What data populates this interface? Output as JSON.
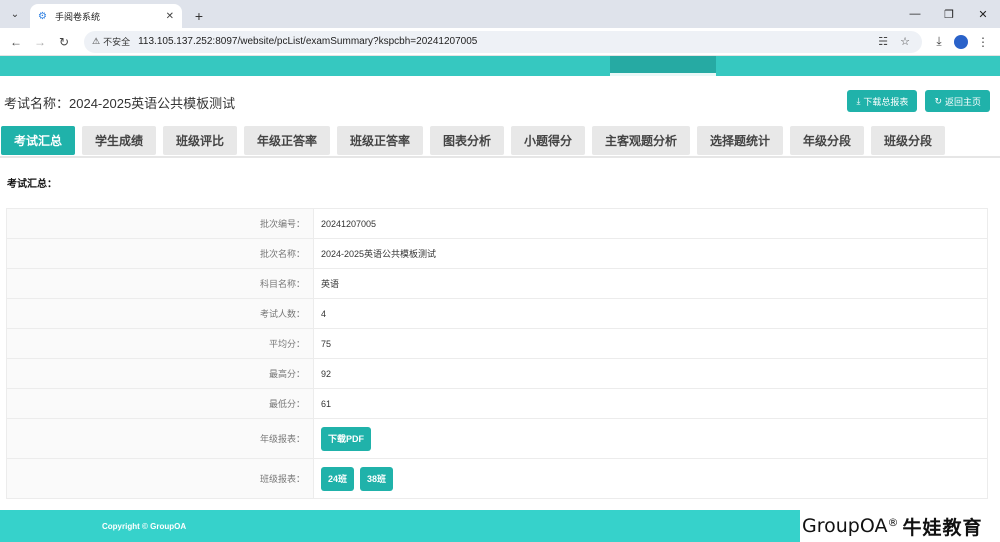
{
  "browser": {
    "tab_title": "手阅卷系统",
    "insecure_label": "不安全",
    "url": "113.105.137.252:8097/website/pcList/examSummary?kspcbh=20241207005"
  },
  "page": {
    "title_label": "考试名称：",
    "title_value": "2024-2025英语公共模板测试",
    "download_report": "下载总报表",
    "back_home": "返回主页"
  },
  "tabs": [
    {
      "label": "考试汇总",
      "active": true
    },
    {
      "label": "学生成绩"
    },
    {
      "label": "班级评比"
    },
    {
      "label": "年级正答率"
    },
    {
      "label": "班级正答率"
    },
    {
      "label": "图表分析"
    },
    {
      "label": "小题得分"
    },
    {
      "label": "主客观题分析"
    },
    {
      "label": "选择题统计"
    },
    {
      "label": "年级分段"
    },
    {
      "label": "班级分段"
    }
  ],
  "section_title": "考试汇总：",
  "summary": {
    "batch_no_label": "批次编号：",
    "batch_no": "20241207005",
    "batch_name_label": "批次名称：",
    "batch_name": "2024-2025英语公共模板测试",
    "subject_label": "科目名称：",
    "subject": "英语",
    "count_label": "考试人数：",
    "count": "4",
    "avg_label": "平均分：",
    "avg": "75",
    "max_label": "最高分：",
    "max": "92",
    "min_label": "最低分：",
    "min": "61",
    "grade_report_label": "年级报表：",
    "grade_report_btn": "下载PDF",
    "class_report_label": "班级报表：",
    "class_btns": [
      "24班",
      "38班"
    ]
  },
  "footer": {
    "copyright": "Copyright © GroupOA",
    "brand_en": "GroupOA",
    "brand_reg": "®",
    "brand_cn": "牛娃教育"
  },
  "colors": {
    "accent": "#20b2aa",
    "header": "#36c8c0"
  }
}
